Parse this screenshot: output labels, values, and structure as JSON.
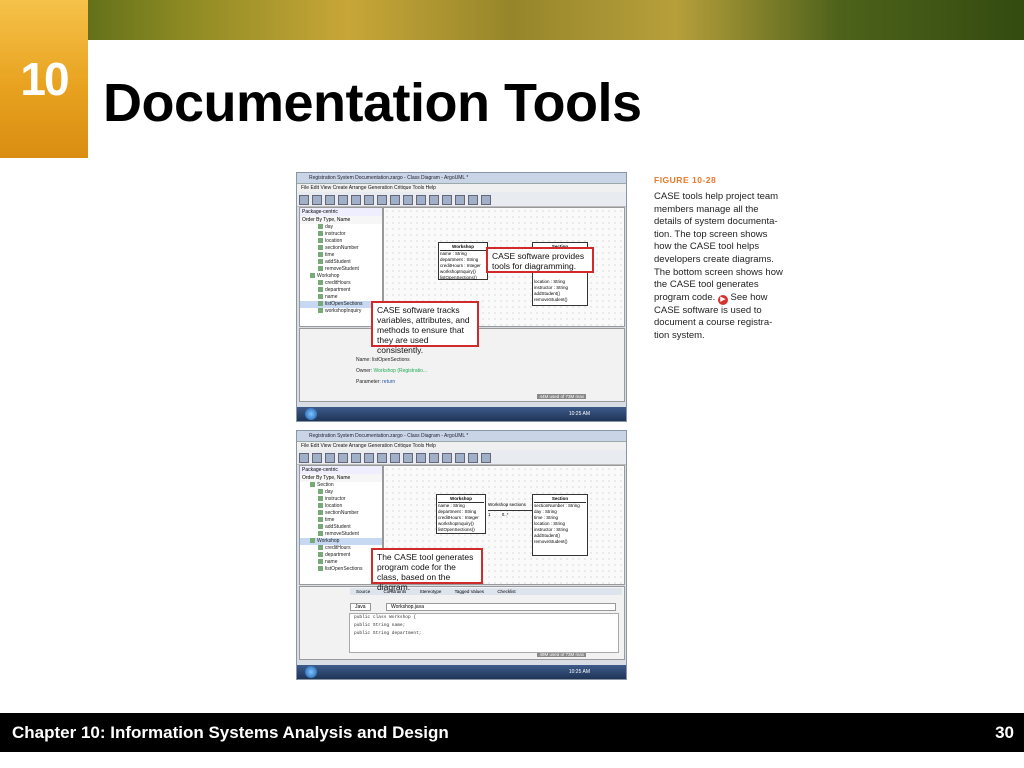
{
  "header": {
    "chapter_number": "10",
    "title": "Documentation Tools"
  },
  "figure": {
    "label": "FIGURE 10-28",
    "caption_part1": "CASE tools help project team members manage all the details of system documenta-tion. The top screen shows how the CASE tool helps developers create diagrams. The bottom screen shows how the CASE tool generates program code.",
    "caption_part2": "See how CASE software is used to document a course registra-tion system.",
    "top_screen": {
      "window_title": "Registration System Documentation.zargo - Class Diagram - ArgoUML *",
      "menu": "File  Edit  View  Create  Arrange  Generation  Critique  Tools  Help",
      "package_dropdown": "Package-centric",
      "order_by": "Order By Type, Name",
      "tree_items": [
        "day",
        "instructor",
        "location",
        "sectionNumber",
        "time",
        "addStudent",
        "removeStudent",
        "Workshop",
        "creditHours",
        "department",
        "name",
        "listOpenSections",
        "workshopInquiry"
      ],
      "class_workshop": {
        "name": "Workshop",
        "attributes": [
          "name : String",
          "department : String",
          "creditHours : Integer"
        ],
        "operations": [
          "workshopInquiry()",
          "listOpenSections()"
        ]
      },
      "class_section": {
        "name": "Section",
        "attributes": [
          "location : String",
          "instructor : String"
        ],
        "operations": [
          "addStudent()",
          "removeStudent()"
        ]
      },
      "callout_diagramming": "CASE software provides tools for diagramming.",
      "callout_tracking": "CASE software tracks variables, attributes, and methods to ensure that they are used consistently.",
      "operation_panel": {
        "name_label": "Name:",
        "name_value": "listOpenSections",
        "owner_label": "Owner:",
        "owner_value": "Workshop (Registratio...",
        "parameter_label": "Parameter:",
        "parameter_value": "return"
      },
      "status": "44M used of 73M max",
      "clock": "10:25 AM"
    },
    "bottom_screen": {
      "window_title": "Registration System Documentation.zargo - Class Diagram - ArgoUML *",
      "menu": "File  Edit  View  Create  Arrange  Generation  Critique  Tools  Help",
      "package_dropdown": "Package-centric",
      "order_by": "Order By Type, Name",
      "tree_items": [
        "Section",
        "day",
        "instructor",
        "location",
        "sectionNumber",
        "time",
        "addStudent",
        "removeStudent",
        "Workshop",
        "creditHours",
        "department",
        "name",
        "listOpenSections"
      ],
      "class_workshop": {
        "name": "Workshop",
        "attributes": [
          "name : String",
          "department : String",
          "creditHours : Integer"
        ],
        "operations": [
          "workshopInquiry()",
          "listOpenSections()"
        ]
      },
      "class_section": {
        "name": "Section",
        "attributes": [
          "sectionNumber : String",
          "day : String",
          "time : String",
          "location : String",
          "instructor : String"
        ],
        "operations": [
          "addStudent()",
          "removeStudent()"
        ]
      },
      "association": "Workshop sections",
      "multiplicity": "1         0..*",
      "callout_code": "The CASE tool generates program code for the class, based on the diagram.",
      "tabs": [
        "Source",
        "Constraints",
        "Stereotype",
        "Tagged Values",
        "Checklist"
      ],
      "language": "Java",
      "file": "Workshop.java",
      "code_lines": [
        "public class Workshop {",
        "  public String name;",
        "  public String department;"
      ],
      "status": "49M used of 73M max",
      "clock": "10:25 AM"
    }
  },
  "footer": {
    "left": "Chapter 10: Information Systems Analysis and Design",
    "page": "30"
  }
}
